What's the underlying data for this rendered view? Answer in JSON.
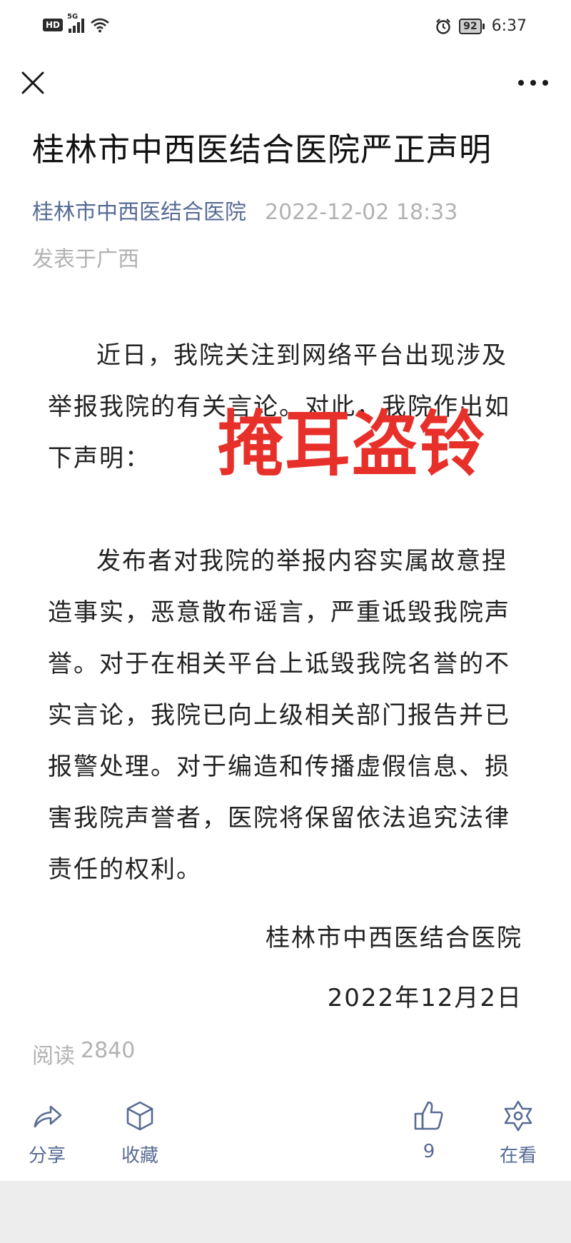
{
  "status_bar": {
    "hd_label": "HD",
    "network_label": "5G",
    "battery_level": "92",
    "time": "6:37"
  },
  "icons": {
    "close": "close-icon",
    "more": "more-dots-icon",
    "alarm": "alarm-icon",
    "signal": "signal-icon",
    "wifi": "wifi-icon"
  },
  "article": {
    "title": "桂林市中西医结合医院严正声明",
    "account_name": "桂林市中西医结合医院",
    "publish_time": "2022-12-02 18:33",
    "location": "发表于广西",
    "paragraph_1": "近日，我院关注到网络平台出现涉及举报我院的有关言论。对此，我院作出如下声明：",
    "paragraph_2": "发布者对我院的举报内容实属故意捏造事实，恶意散布谣言，严重诋毁我院声誉。对于在相关平台上诋毁我院名誉的不实言论，我院已向上级相关部门报告并已报警处理。对于编造和传播虚假信息、损害我院声誉者，医院将保留依法追究法律责任的权利。",
    "signature_name": "桂林市中西医结合医院",
    "signature_date": "2022年12月2日"
  },
  "overlay": {
    "stamp_text": "掩耳盗铃",
    "stamp_color": "#e8302a"
  },
  "footer": {
    "read_label": "阅读",
    "read_count": "2840",
    "share_label": "分享",
    "favorite_label": "收藏",
    "like_count": "9",
    "looking_label": "在看"
  },
  "colors": {
    "link_blue": "#576b95",
    "meta_gray": "#b2b2b2"
  }
}
